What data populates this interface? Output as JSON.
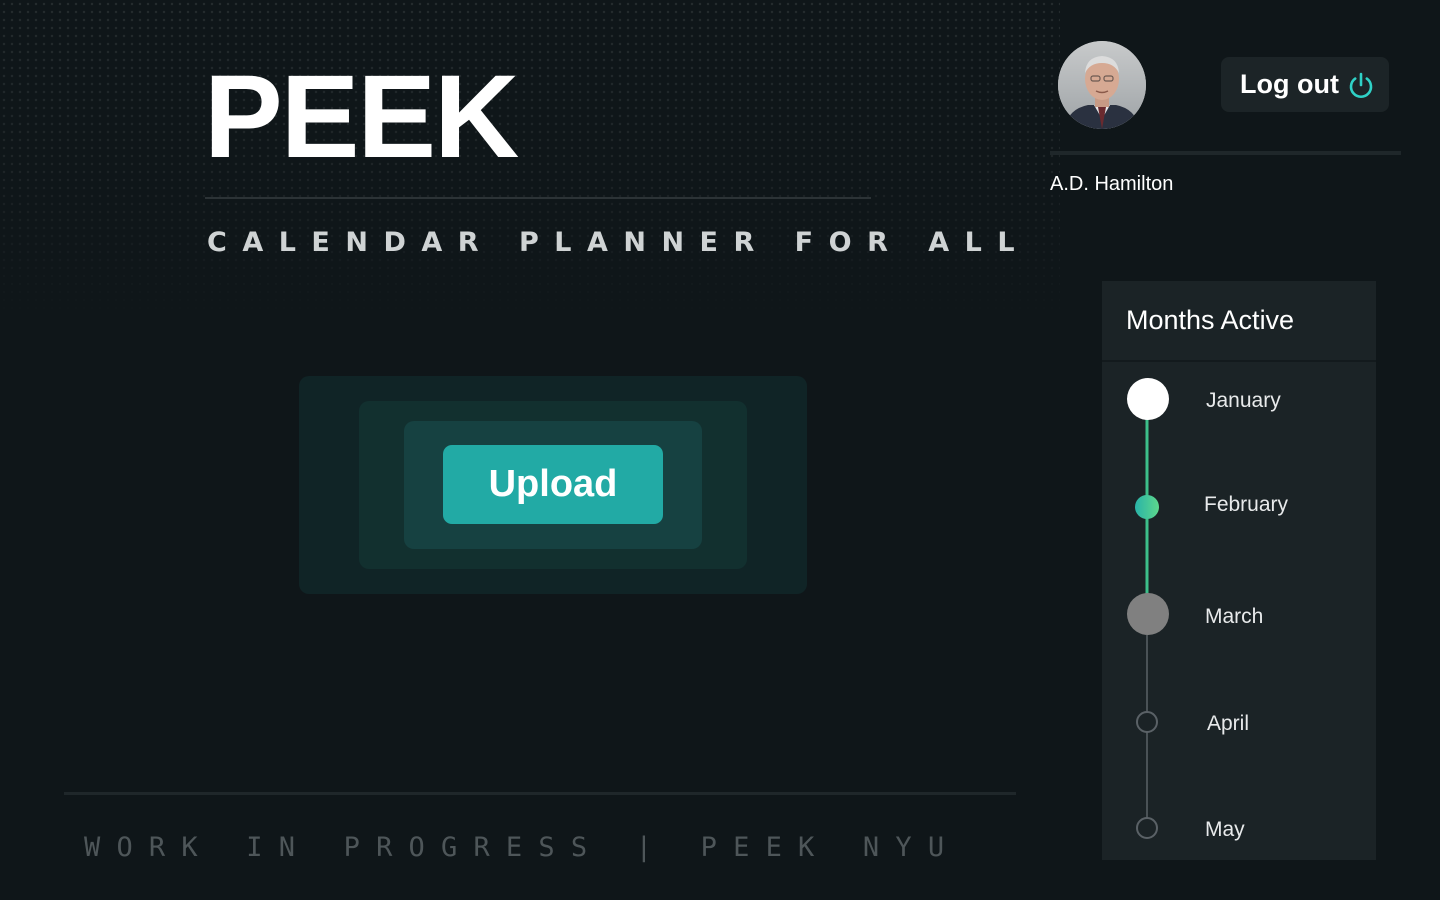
{
  "brand": {
    "title": "PEEK",
    "tagline": "CALENDAR PLANNER FOR ALL"
  },
  "upload": {
    "label": "Upload"
  },
  "user": {
    "name": "A.D. Hamilton",
    "avatar": "user-photo",
    "logout_label": "Log out",
    "logout_icon": "power-icon"
  },
  "months_panel": {
    "title": "Months Active",
    "months": [
      {
        "label": "January",
        "status": "completed"
      },
      {
        "label": "February",
        "status": "current"
      },
      {
        "label": "March",
        "status": "next"
      },
      {
        "label": "April",
        "status": "inactive"
      },
      {
        "label": "May",
        "status": "inactive"
      }
    ]
  },
  "footer": {
    "text": "WORK IN PROGRESS | PEEK NYU"
  },
  "colors": {
    "background": "#0f1619",
    "accent_teal": "#22aaa5",
    "power_icon": "#2fd1c6",
    "timeline_active": "#3dbf8a",
    "timeline_inactive": "#4a5256"
  }
}
